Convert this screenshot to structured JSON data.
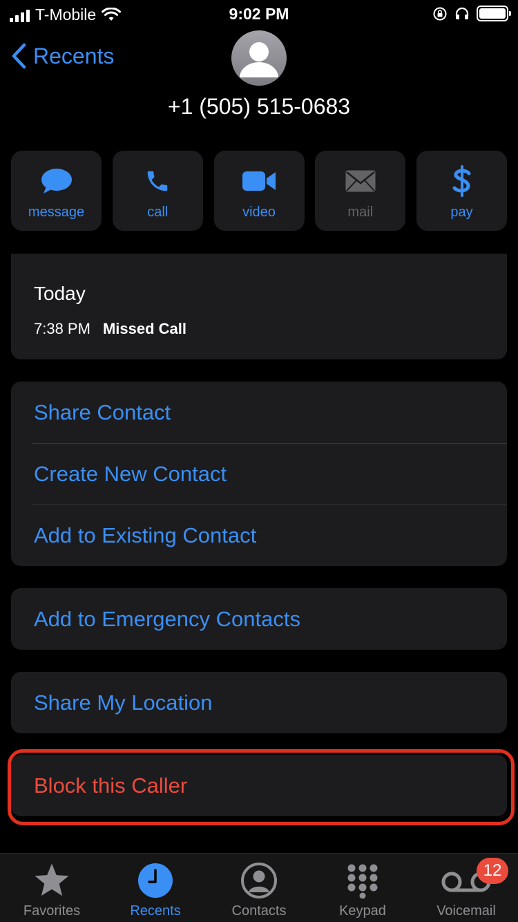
{
  "status_bar": {
    "carrier": "T-Mobile",
    "time": "9:02 PM"
  },
  "nav": {
    "back_label": "Recents"
  },
  "contact": {
    "phone": "+1 (505) 515-0683"
  },
  "actions": [
    {
      "label": "message",
      "icon": "message-bubble-icon",
      "enabled": true
    },
    {
      "label": "call",
      "icon": "phone-icon",
      "enabled": true
    },
    {
      "label": "video",
      "icon": "video-camera-icon",
      "enabled": true
    },
    {
      "label": "mail",
      "icon": "envelope-icon",
      "enabled": false
    },
    {
      "label": "pay",
      "icon": "dollar-icon",
      "enabled": true
    }
  ],
  "history": {
    "day": "Today",
    "time": "7:38 PM",
    "type": "Missed Call"
  },
  "menu": {
    "share_contact": "Share Contact",
    "create_new_contact": "Create New Contact",
    "add_existing_contact": "Add to Existing Contact",
    "add_emergency": "Add to Emergency Contacts",
    "share_location": "Share My Location",
    "block_caller": "Block this Caller"
  },
  "tabs": [
    {
      "label": "Favorites",
      "icon": "star-icon",
      "active": false
    },
    {
      "label": "Recents",
      "icon": "clock-icon",
      "active": true
    },
    {
      "label": "Contacts",
      "icon": "person-circle-icon",
      "active": false
    },
    {
      "label": "Keypad",
      "icon": "keypad-icon",
      "active": false
    },
    {
      "label": "Voicemail",
      "icon": "voicemail-icon",
      "active": false,
      "badge": "12"
    }
  ],
  "colors": {
    "accent": "#3a8ff5",
    "danger": "#eb4b3d",
    "card": "#1c1c1e",
    "highlight": "#e2301e"
  }
}
